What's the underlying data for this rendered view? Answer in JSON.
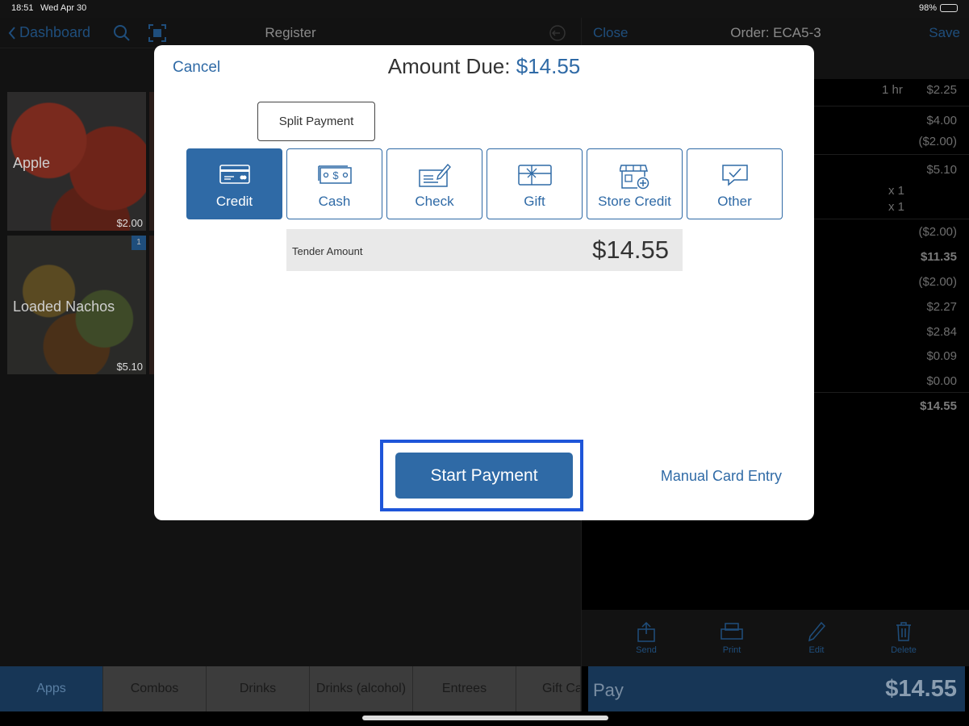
{
  "status_bar": {
    "time": "18:51",
    "date": "Wed Apr 30",
    "battery": "98%"
  },
  "register": {
    "back_label": "Dashboard",
    "title": "Register",
    "tiles": [
      {
        "name": "Apple",
        "price": "$2.00"
      },
      {
        "name": "Loaded Nachos",
        "price": "$5.10",
        "badge": "1"
      }
    ],
    "categories": [
      "Apps",
      "Combos",
      "Drinks",
      "Drinks (alcohol)",
      "Entrees",
      "Gift Ca"
    ]
  },
  "order": {
    "close_label": "Close",
    "title": "Order: ECA5-3",
    "save_label": "Save",
    "lines": [
      {
        "mid": "1 hr",
        "value": "$2.25"
      },
      {
        "value": "$4.00"
      },
      {
        "value": "($2.00)"
      },
      {
        "value": "$5.10"
      },
      {
        "mid": "x 1"
      },
      {
        "mid": "x 1"
      },
      {
        "value": "($2.00)"
      },
      {
        "value": "$11.35"
      },
      {
        "value": "($2.00)"
      },
      {
        "value": "$2.27"
      },
      {
        "value": "$2.84"
      },
      {
        "value": "$0.09"
      },
      {
        "value": "$0.00"
      },
      {
        "value": "$14.55"
      }
    ],
    "actions": [
      "Send",
      "Print",
      "Edit",
      "Delete"
    ],
    "pay_label": "Pay",
    "pay_amount": "$14.55"
  },
  "modal": {
    "cancel_label": "Cancel",
    "amount_due_label": "Amount Due:",
    "amount_due_value": "$14.55",
    "split_label": "Split Payment",
    "payment_types": [
      {
        "label": "Credit",
        "icon": "credit-card-icon",
        "active": true
      },
      {
        "label": "Cash",
        "icon": "cash-icon"
      },
      {
        "label": "Check",
        "icon": "check-icon"
      },
      {
        "label": "Gift",
        "icon": "gift-card-icon"
      },
      {
        "label": "Store Credit",
        "icon": "store-credit-icon"
      },
      {
        "label": "Other",
        "icon": "other-icon"
      }
    ],
    "tender_label": "Tender Amount",
    "tender_value": "$14.55",
    "start_label": "Start Payment",
    "manual_label": "Manual Card Entry"
  },
  "colors": {
    "accent": "#2f6aa6",
    "highlight": "#1e55d9"
  }
}
